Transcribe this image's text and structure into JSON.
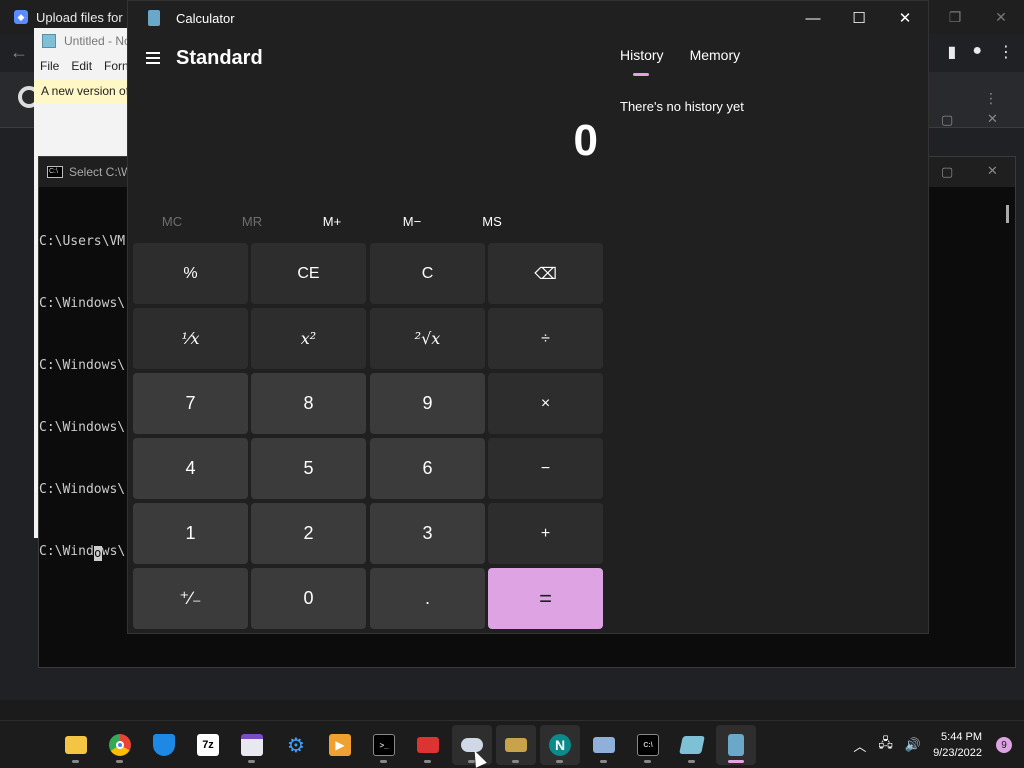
{
  "browser": {
    "tab_title": "Upload files for",
    "tab_icon": "docs-icon"
  },
  "notepad": {
    "title": "Untitled - No",
    "menu": [
      "File",
      "Edit",
      "Forn"
    ],
    "banner": "A new version of"
  },
  "terminal": {
    "title": "Select C:\\W",
    "lines": [
      "C:\\Users\\VM",
      "C:\\Windows\\",
      "C:\\Windows\\",
      "C:\\Windows\\",
      "C:\\Windows\\"
    ],
    "current_line_before": "C:\\Wind",
    "current_line_cursor": "o",
    "current_line_after": "ws\\"
  },
  "calculator": {
    "title": "Calculator",
    "mode": "Standard",
    "display": "0",
    "memory_buttons": [
      {
        "label": "MC",
        "enabled": false
      },
      {
        "label": "MR",
        "enabled": false
      },
      {
        "label": "M+",
        "enabled": true
      },
      {
        "label": "M−",
        "enabled": true
      },
      {
        "label": "MS",
        "enabled": true
      }
    ],
    "keys": {
      "percent": "%",
      "ce": "CE",
      "c": "C",
      "backspace": "⌫",
      "reciprocal": "⅟x",
      "square": "x²",
      "sqrt": "²√x",
      "divide": "÷",
      "seven": "7",
      "eight": "8",
      "nine": "9",
      "multiply": "×",
      "four": "4",
      "five": "5",
      "six": "6",
      "minus": "−",
      "one": "1",
      "two": "2",
      "three": "3",
      "plus": "+",
      "negate": "⁺∕₋",
      "zero": "0",
      "decimal": ".",
      "equals": "="
    },
    "tabs": {
      "history": "History",
      "memory": "Memory"
    },
    "history_empty": "There's no history yet",
    "accent_color": "#dda3e3"
  },
  "taskbar": {
    "apps": [
      {
        "name": "start",
        "icon": "windows-start-icon"
      },
      {
        "name": "file-explorer",
        "icon": "folder-icon"
      },
      {
        "name": "chrome",
        "icon": "chrome-icon"
      },
      {
        "name": "defender",
        "icon": "shield-icon"
      },
      {
        "name": "7zip",
        "icon": "7zip-icon",
        "label": "7z"
      },
      {
        "name": "app-browser",
        "icon": "window-icon"
      },
      {
        "name": "app-gear",
        "icon": "cog-icon"
      },
      {
        "name": "media",
        "icon": "play-icon"
      },
      {
        "name": "terminal",
        "icon": "terminal-icon"
      },
      {
        "name": "toolbox",
        "icon": "toolbox-icon"
      },
      {
        "name": "app-car",
        "icon": "car-icon"
      },
      {
        "name": "scanner",
        "icon": "scanner-icon"
      },
      {
        "name": "netscape",
        "icon": "netscape-icon",
        "label": "N"
      },
      {
        "name": "network",
        "icon": "network-icon"
      },
      {
        "name": "cmd",
        "icon": "cmd-icon"
      },
      {
        "name": "notepad",
        "icon": "notepad-icon"
      },
      {
        "name": "calculator",
        "icon": "calculator-icon"
      }
    ],
    "time": "5:44 PM",
    "date": "9/23/2022",
    "notification_count": "9"
  }
}
